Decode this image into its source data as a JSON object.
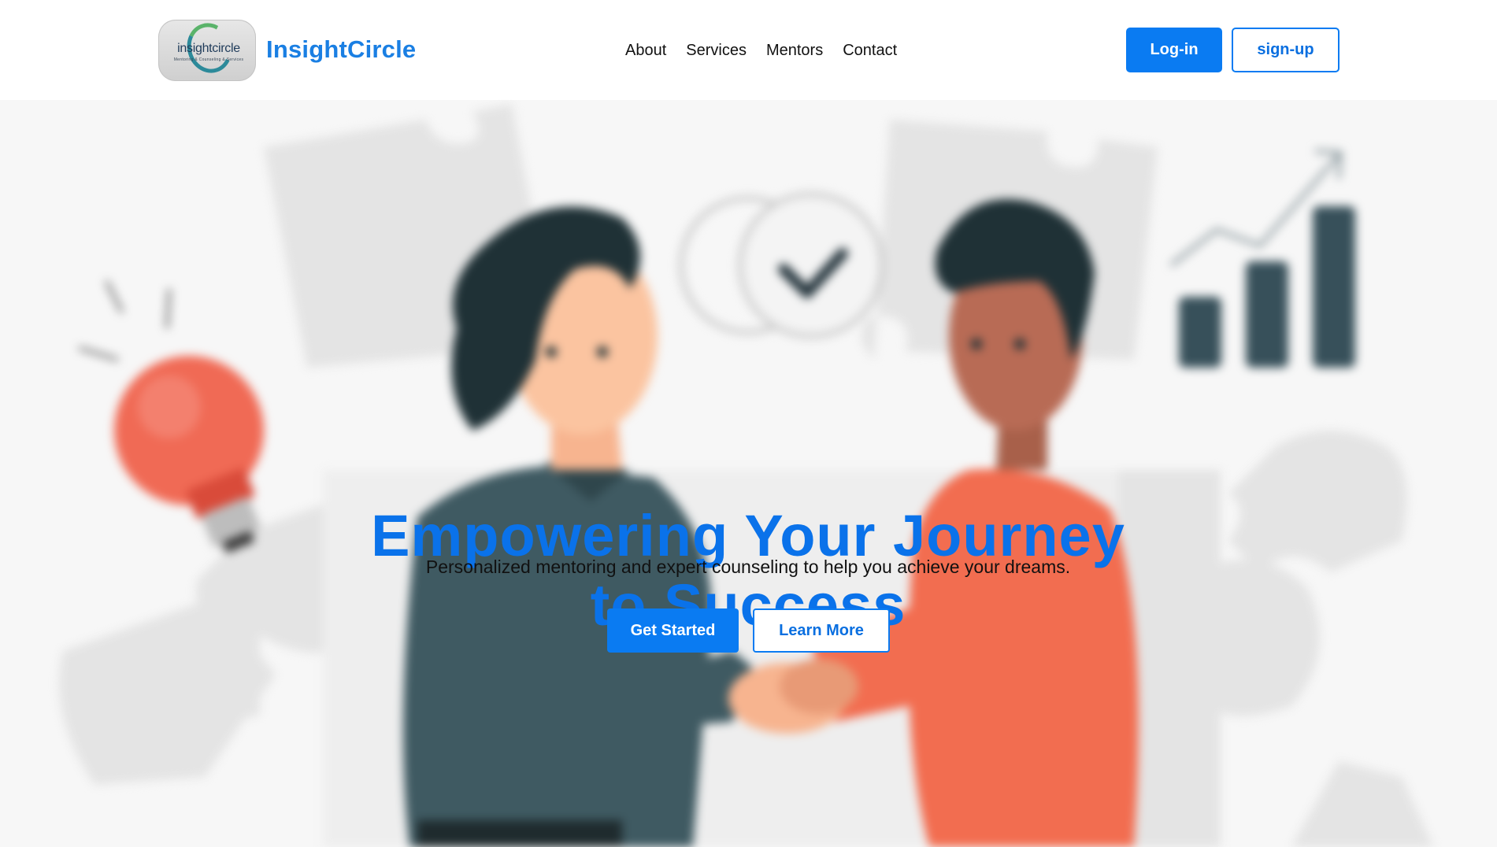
{
  "header": {
    "logo": {
      "word": "insightcircle",
      "tagline": "Mentoring & Counseling & Services"
    },
    "brand_name": "InsightCircle",
    "nav": [
      {
        "label": "About"
      },
      {
        "label": "Services"
      },
      {
        "label": "Mentors"
      },
      {
        "label": "Contact"
      }
    ],
    "login_label": "Log-in",
    "signup_label": "sign-up"
  },
  "hero": {
    "title_line1": "Empowering Your Journey",
    "title_line2": "to Success",
    "subtitle": "Personalized mentoring and expert counseling to help you achieve your dreams.",
    "get_started_label": "Get Started",
    "learn_more_label": "Learn More",
    "illustration": "handshake-puzzle-illustration"
  },
  "colors": {
    "accent": "#0a7bf2",
    "brand": "#1a7fe3",
    "title": "#0a72ea"
  }
}
